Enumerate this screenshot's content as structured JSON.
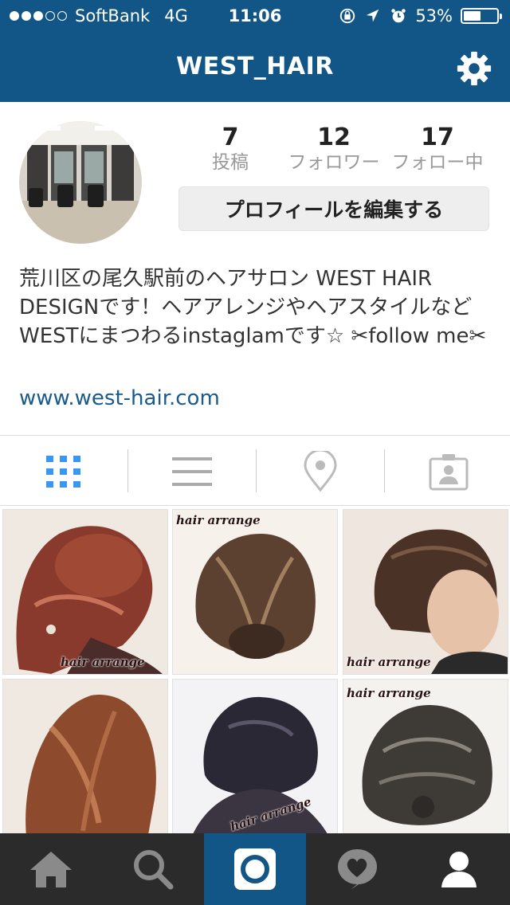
{
  "status_bar": {
    "carrier": "SoftBank",
    "network": "4G",
    "time": "11:06",
    "battery": "53%",
    "battery_level": 0.53,
    "signal_filled": 3,
    "signal_total": 5
  },
  "nav": {
    "title": "WEST_HAIR",
    "settings_icon": "gear-icon"
  },
  "profile": {
    "stats": [
      {
        "count": "7",
        "label": "投稿"
      },
      {
        "count": "12",
        "label": "フォロワー"
      },
      {
        "count": "17",
        "label": "フォロー中"
      }
    ],
    "edit_button": "プロフィールを編集する",
    "bio": "荒川区の尾久駅前のヘアサロン WEST HAIR DESIGNです！ヘアアレンジやヘアスタイルなどWESTにまつわるinstaglamです☆ ✂follow me✂",
    "website": "www.west-hair.com"
  },
  "tabs": [
    {
      "icon": "grid-icon",
      "active": true
    },
    {
      "icon": "list-icon",
      "active": false
    },
    {
      "icon": "location-pin-icon",
      "active": false
    },
    {
      "icon": "tagged-person-icon",
      "active": false
    }
  ],
  "photos": [
    {
      "caption": "hair arrange"
    },
    {
      "caption": "hair arrange"
    },
    {
      "caption": "hair arrange"
    },
    {
      "caption": ""
    },
    {
      "caption": "hair arrange"
    },
    {
      "caption": "hair arrange"
    }
  ],
  "bottom_nav": [
    {
      "icon": "home-icon",
      "active": false
    },
    {
      "icon": "search-icon",
      "active": false
    },
    {
      "icon": "camera-icon",
      "active": true
    },
    {
      "icon": "activity-heart-icon",
      "active": false
    },
    {
      "icon": "profile-icon",
      "active": false
    }
  ],
  "colors": {
    "brand": "#125688",
    "active_tab": "#3897f0",
    "link": "#1a5a8c",
    "bottom_bar": "#2b2b2b"
  }
}
